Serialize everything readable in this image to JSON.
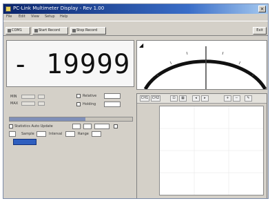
{
  "window": {
    "title": "PC-Link Multimeter Display - Rev 1.00",
    "close_glyph": "×"
  },
  "menu": [
    "File",
    "Edit",
    "View",
    "Setup",
    "Help"
  ],
  "toolbar": {
    "buttons": [
      "COM1",
      "Start Record",
      "Stop Record"
    ],
    "right_button": "Exit"
  },
  "display": {
    "reading": "- 19999"
  },
  "gauge": {
    "corner_glyph": "◢",
    "colors": {
      "arc": "#111111",
      "needle": "#444444"
    }
  },
  "controls": {
    "min_label": "MIN",
    "max_label": "MAX",
    "rel_label": "Relative",
    "hold_label": "Holding",
    "slider_fraction": 0.62,
    "options_label": "Statistics Auto Update",
    "dropdown_labels": [
      "Sample",
      "Interval",
      "Range"
    ],
    "action_color": "#2f5fbf"
  },
  "chart_toolbar": {
    "buttons": [
      "CH1",
      "CH2",
      "⊡",
      "▦",
      "◂",
      "▸",
      "+",
      "−",
      "✎"
    ]
  },
  "chart_data": {
    "type": "line",
    "x": [],
    "series": [],
    "ylabel": "",
    "xlabel": "",
    "grid": true
  },
  "colors": {
    "window_face": "#d4d0c8",
    "titlebar": "#0a246a",
    "accent": "#2f5fbf"
  }
}
